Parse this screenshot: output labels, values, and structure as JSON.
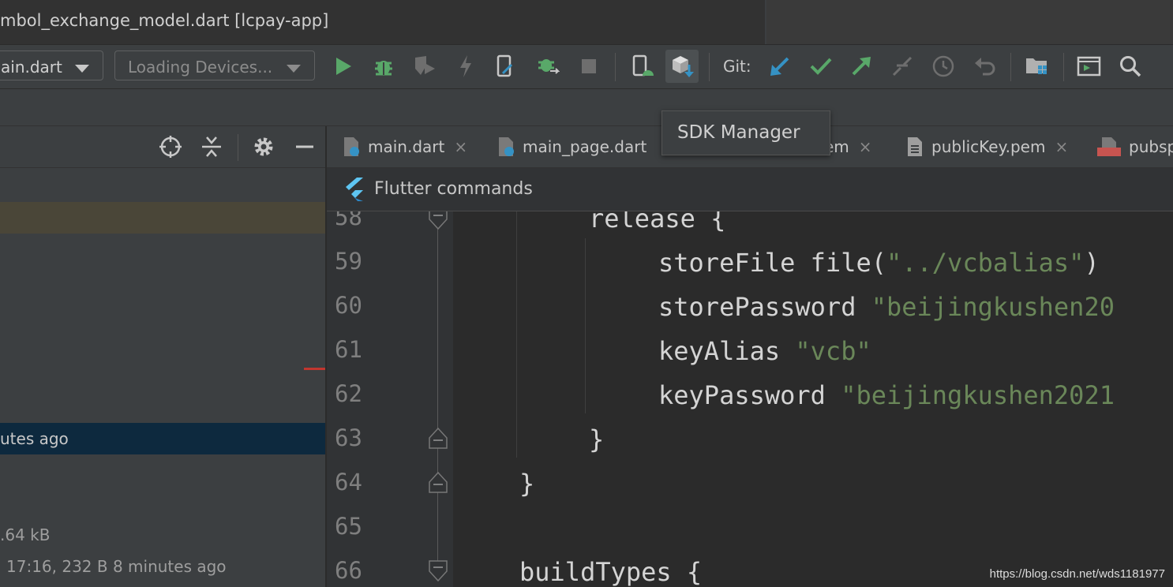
{
  "window": {
    "title": "mbol_exchange_model.dart [lcpay-app]"
  },
  "toolbar": {
    "config_select": "ain.dart",
    "device_select": "Loading Devices...",
    "git_label": "Git:"
  },
  "tooltip": {
    "text": "SDK Manager"
  },
  "left_panel": {
    "rows": [
      {
        "text": "utes ago"
      },
      {
        "text": ".64 kB"
      },
      {
        "text": "17:16, 232 B 8 minutes ago"
      }
    ]
  },
  "tabs": [
    {
      "label": "main.dart",
      "close": "×"
    },
    {
      "label": "main_page.dart",
      "close": ""
    },
    {
      "label": "em",
      "close": "×"
    },
    {
      "label": "publicKey.pem",
      "close": "×"
    },
    {
      "label": "pubsp",
      "close": ""
    }
  ],
  "notice": {
    "text": "Flutter commands"
  },
  "editor": {
    "line_numbers": [
      "58",
      "59",
      "60",
      "61",
      "62",
      "63",
      "64",
      "65",
      "66"
    ],
    "code": {
      "l58": "release {",
      "l59_kw": "storeFile file(",
      "l59_str": "\"../vcbalias\"",
      "l59_end": ")",
      "l60_kw": "storePassword ",
      "l60_str": "\"beijingkushen20",
      "l61_kw": "keyAlias ",
      "l61_str": "\"vcb\"",
      "l62_kw": "keyPassword ",
      "l62_str": "\"beijingkushen2021",
      "l63": "}",
      "l64": "}",
      "l66": "buildTypes {"
    }
  },
  "watermark": "https://blog.csdn.net/wds1181977",
  "colors": {
    "run_green": "#59a869",
    "git_blue": "#3592c4",
    "string_green": "#6a8759",
    "selection_blue": "#0d293e"
  }
}
